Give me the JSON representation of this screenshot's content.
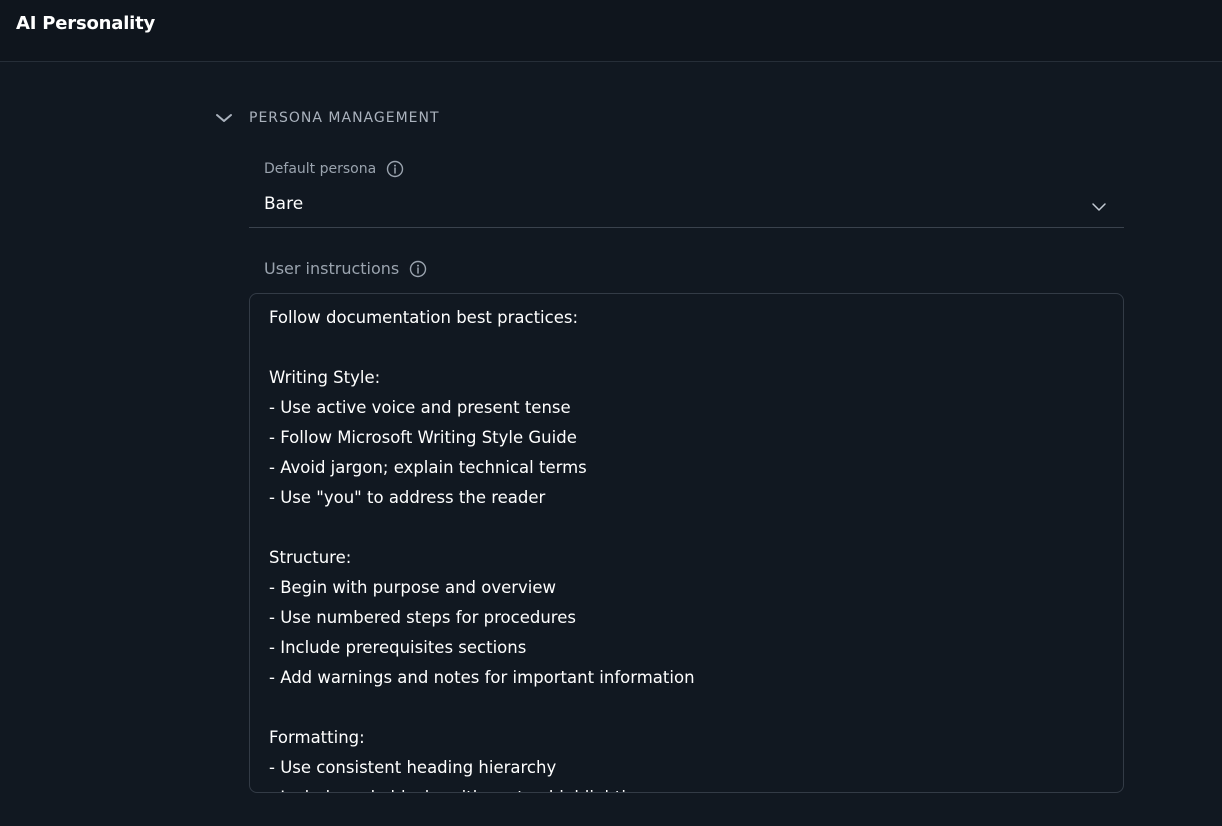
{
  "header": {
    "title": "AI Personality"
  },
  "section": {
    "title": "PERSONA MANAGEMENT",
    "expanded": true
  },
  "default_persona": {
    "label": "Default persona",
    "value": "Bare"
  },
  "user_instructions": {
    "label": "User instructions",
    "lines": [
      "Follow documentation best practices:",
      "",
      "Writing Style:",
      "- Use active voice and present tense",
      "- Follow Microsoft Writing Style Guide",
      "- Avoid jargon; explain technical terms",
      "- Use \"you\" to address the reader",
      "",
      "Structure:",
      "- Begin with purpose and overview",
      "- Use numbered steps for procedures",
      "- Include prerequisites sections",
      "- Add warnings and notes for important information",
      "",
      "Formatting:",
      "- Use consistent heading hierarchy",
      "- Include code blocks with syntax highlighting"
    ]
  },
  "icons": {
    "section_toggle": "chevron-down-icon",
    "info": "info-icon",
    "select": "chevron-down-icon"
  },
  "colors": {
    "background": "#111821",
    "header_background": "#0f151d",
    "text_primary": "#ffffff",
    "text_muted": "#9aa3ae",
    "border": "#333b46"
  }
}
